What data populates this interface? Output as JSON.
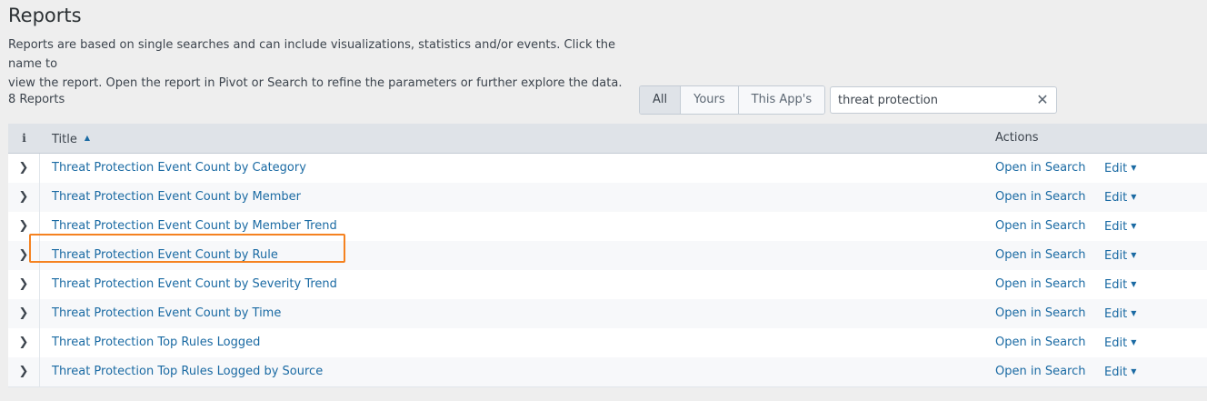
{
  "header": {
    "title": "Reports",
    "description_line1": "Reports are based on single searches and can include visualizations, statistics and/or events. Click the name to",
    "description_line2": "view the report. Open the report in Pivot or Search to refine the parameters or further explore the data."
  },
  "toolbar": {
    "count_label": "8 Reports",
    "filter_tabs": [
      "All",
      "Yours",
      "This App's"
    ],
    "active_tab": "All",
    "search_value": "threat protection",
    "clear_icon": "close-icon"
  },
  "table": {
    "col_info": "i",
    "col_title": "Title",
    "col_actions": "Actions",
    "sort": "ascending",
    "rows": [
      {
        "title": "Threat Protection Event Count by Category",
        "open": "Open in Search",
        "edit": "Edit"
      },
      {
        "title": "Threat Protection Event Count by Member",
        "open": "Open in Search",
        "edit": "Edit"
      },
      {
        "title": "Threat Protection Event Count by Member Trend",
        "open": "Open in Search",
        "edit": "Edit"
      },
      {
        "title": "Threat Protection Event Count by Rule",
        "open": "Open in Search",
        "edit": "Edit"
      },
      {
        "title": "Threat Protection Event Count by Severity Trend",
        "open": "Open in Search",
        "edit": "Edit"
      },
      {
        "title": "Threat Protection Event Count by Time",
        "open": "Open in Search",
        "edit": "Edit"
      },
      {
        "title": "Threat Protection Top Rules Logged",
        "open": "Open in Search",
        "edit": "Edit"
      },
      {
        "title": "Threat Protection Top Rules Logged by Source",
        "open": "Open in Search",
        "edit": "Edit"
      }
    ],
    "highlighted_row": 7
  },
  "colors": {
    "link": "#1a6aa3",
    "highlight": "#f58220",
    "header_bg": "#dfe3e8",
    "page_bg": "#eeeeee"
  }
}
